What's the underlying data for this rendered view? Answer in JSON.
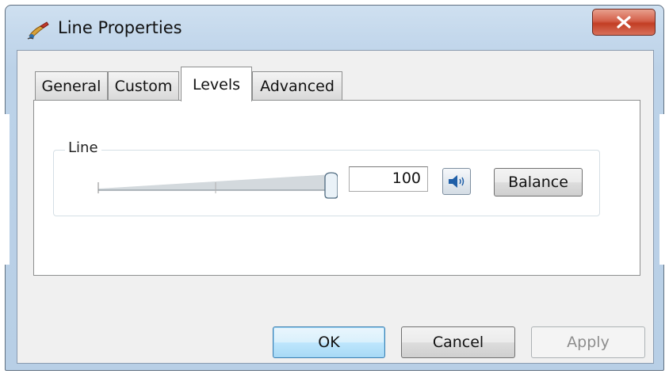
{
  "window": {
    "title": "Line Properties",
    "app_icon": "speaker-brush-icon",
    "close_icon": "close-icon"
  },
  "tabs": [
    {
      "label": "General",
      "active": false
    },
    {
      "label": "Custom",
      "active": false
    },
    {
      "label": "Levels",
      "active": true
    },
    {
      "label": "Advanced",
      "active": false
    }
  ],
  "levels": {
    "group_label": "Line",
    "volume_value": "100",
    "slider_level": 1.0,
    "mute_icon": "speaker-icon",
    "balance_label": "Balance"
  },
  "buttons": {
    "ok": "OK",
    "cancel": "Cancel",
    "apply": "Apply"
  },
  "colors": {
    "close_button": "#c23e24",
    "ok_border": "#3c7fb1",
    "disabled_text": "#8d8d8d"
  }
}
